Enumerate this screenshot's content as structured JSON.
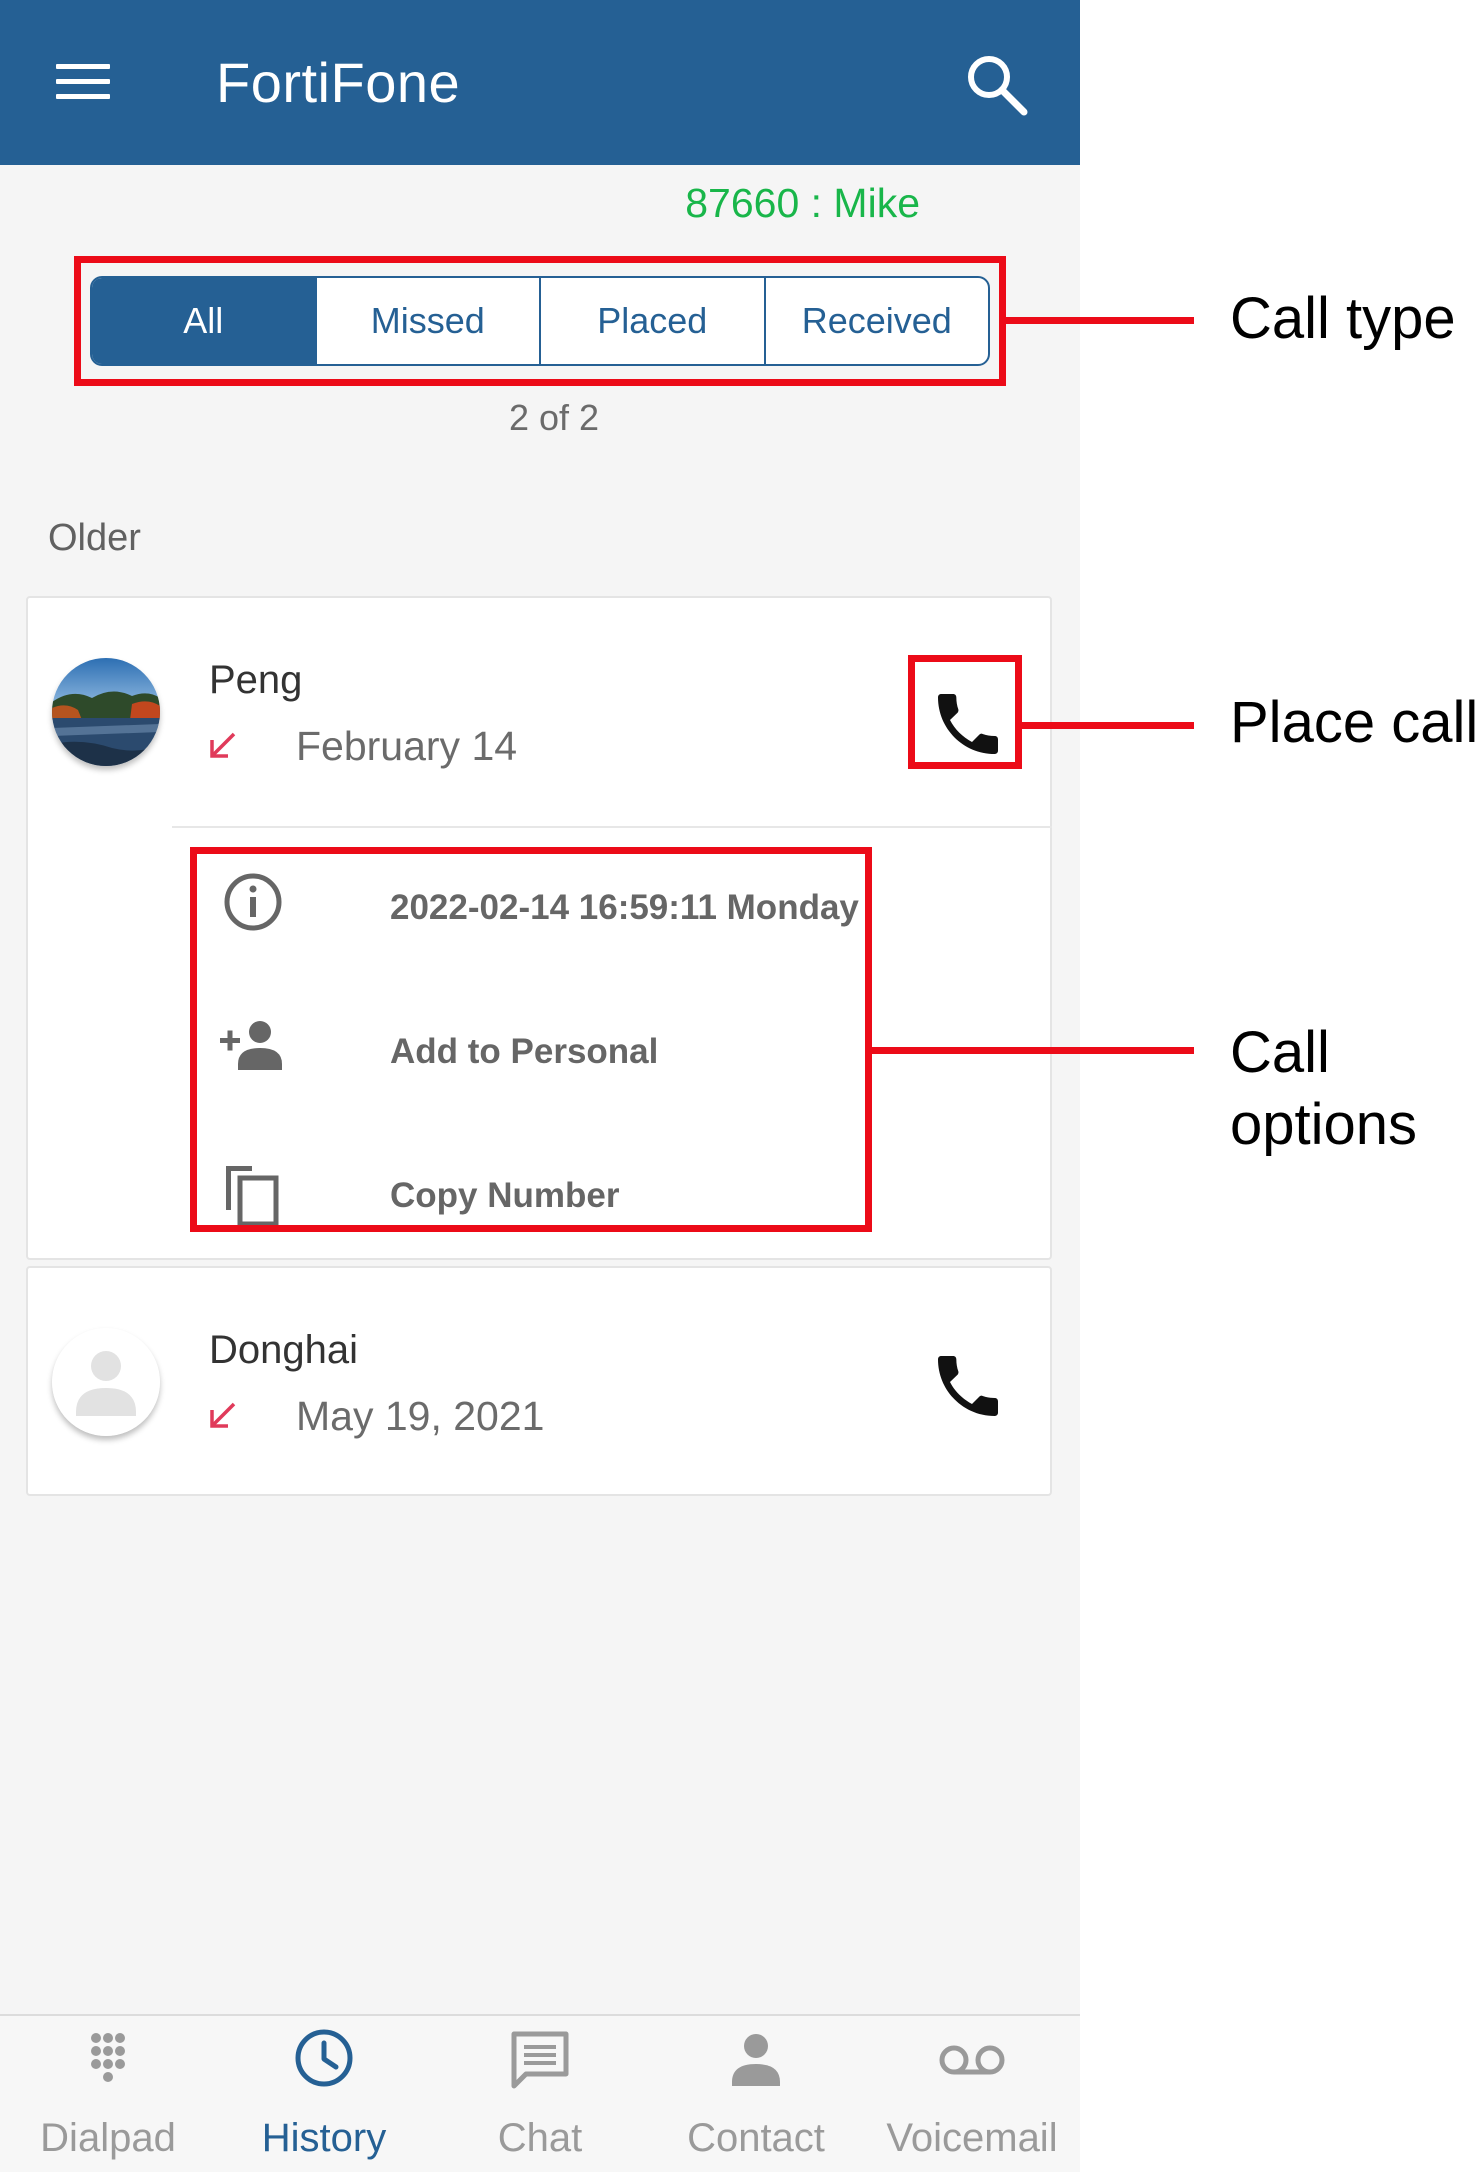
{
  "app": {
    "title": "FortiFone",
    "header_color": "#256094"
  },
  "user_line": "87660 : Mike",
  "filter_tabs": [
    {
      "label": "All",
      "active": true
    },
    {
      "label": "Missed",
      "active": false
    },
    {
      "label": "Placed",
      "active": false
    },
    {
      "label": "Received",
      "active": false
    }
  ],
  "page_count": "2 of 2",
  "section_label": "Older",
  "calls": [
    {
      "name": "Peng",
      "date": "February 14",
      "direction_icon": "incoming-arrow-icon",
      "expanded": true,
      "options": [
        {
          "icon": "info-icon",
          "label": "2022-02-14 16:59:11 Monday"
        },
        {
          "icon": "add-person-icon",
          "label": "Add to Personal"
        },
        {
          "icon": "copy-icon",
          "label": "Copy Number"
        }
      ]
    },
    {
      "name": "Donghai",
      "date": "May 19, 2021",
      "direction_icon": "incoming-arrow-icon",
      "expanded": false
    }
  ],
  "bottom_nav": [
    {
      "label": "Dialpad",
      "icon": "dialpad-icon",
      "active": false
    },
    {
      "label": "History",
      "icon": "clock-icon",
      "active": true
    },
    {
      "label": "Chat",
      "icon": "chat-icon",
      "active": false
    },
    {
      "label": "Contact",
      "icon": "person-icon",
      "active": false
    },
    {
      "label": "Voicemail",
      "icon": "voicemail-icon",
      "active": false
    }
  ],
  "annotations": {
    "call_type": "Call type",
    "place_call": "Place call",
    "call_options_line1": "Call",
    "call_options_line2": "options",
    "color": "#ec0b18"
  }
}
